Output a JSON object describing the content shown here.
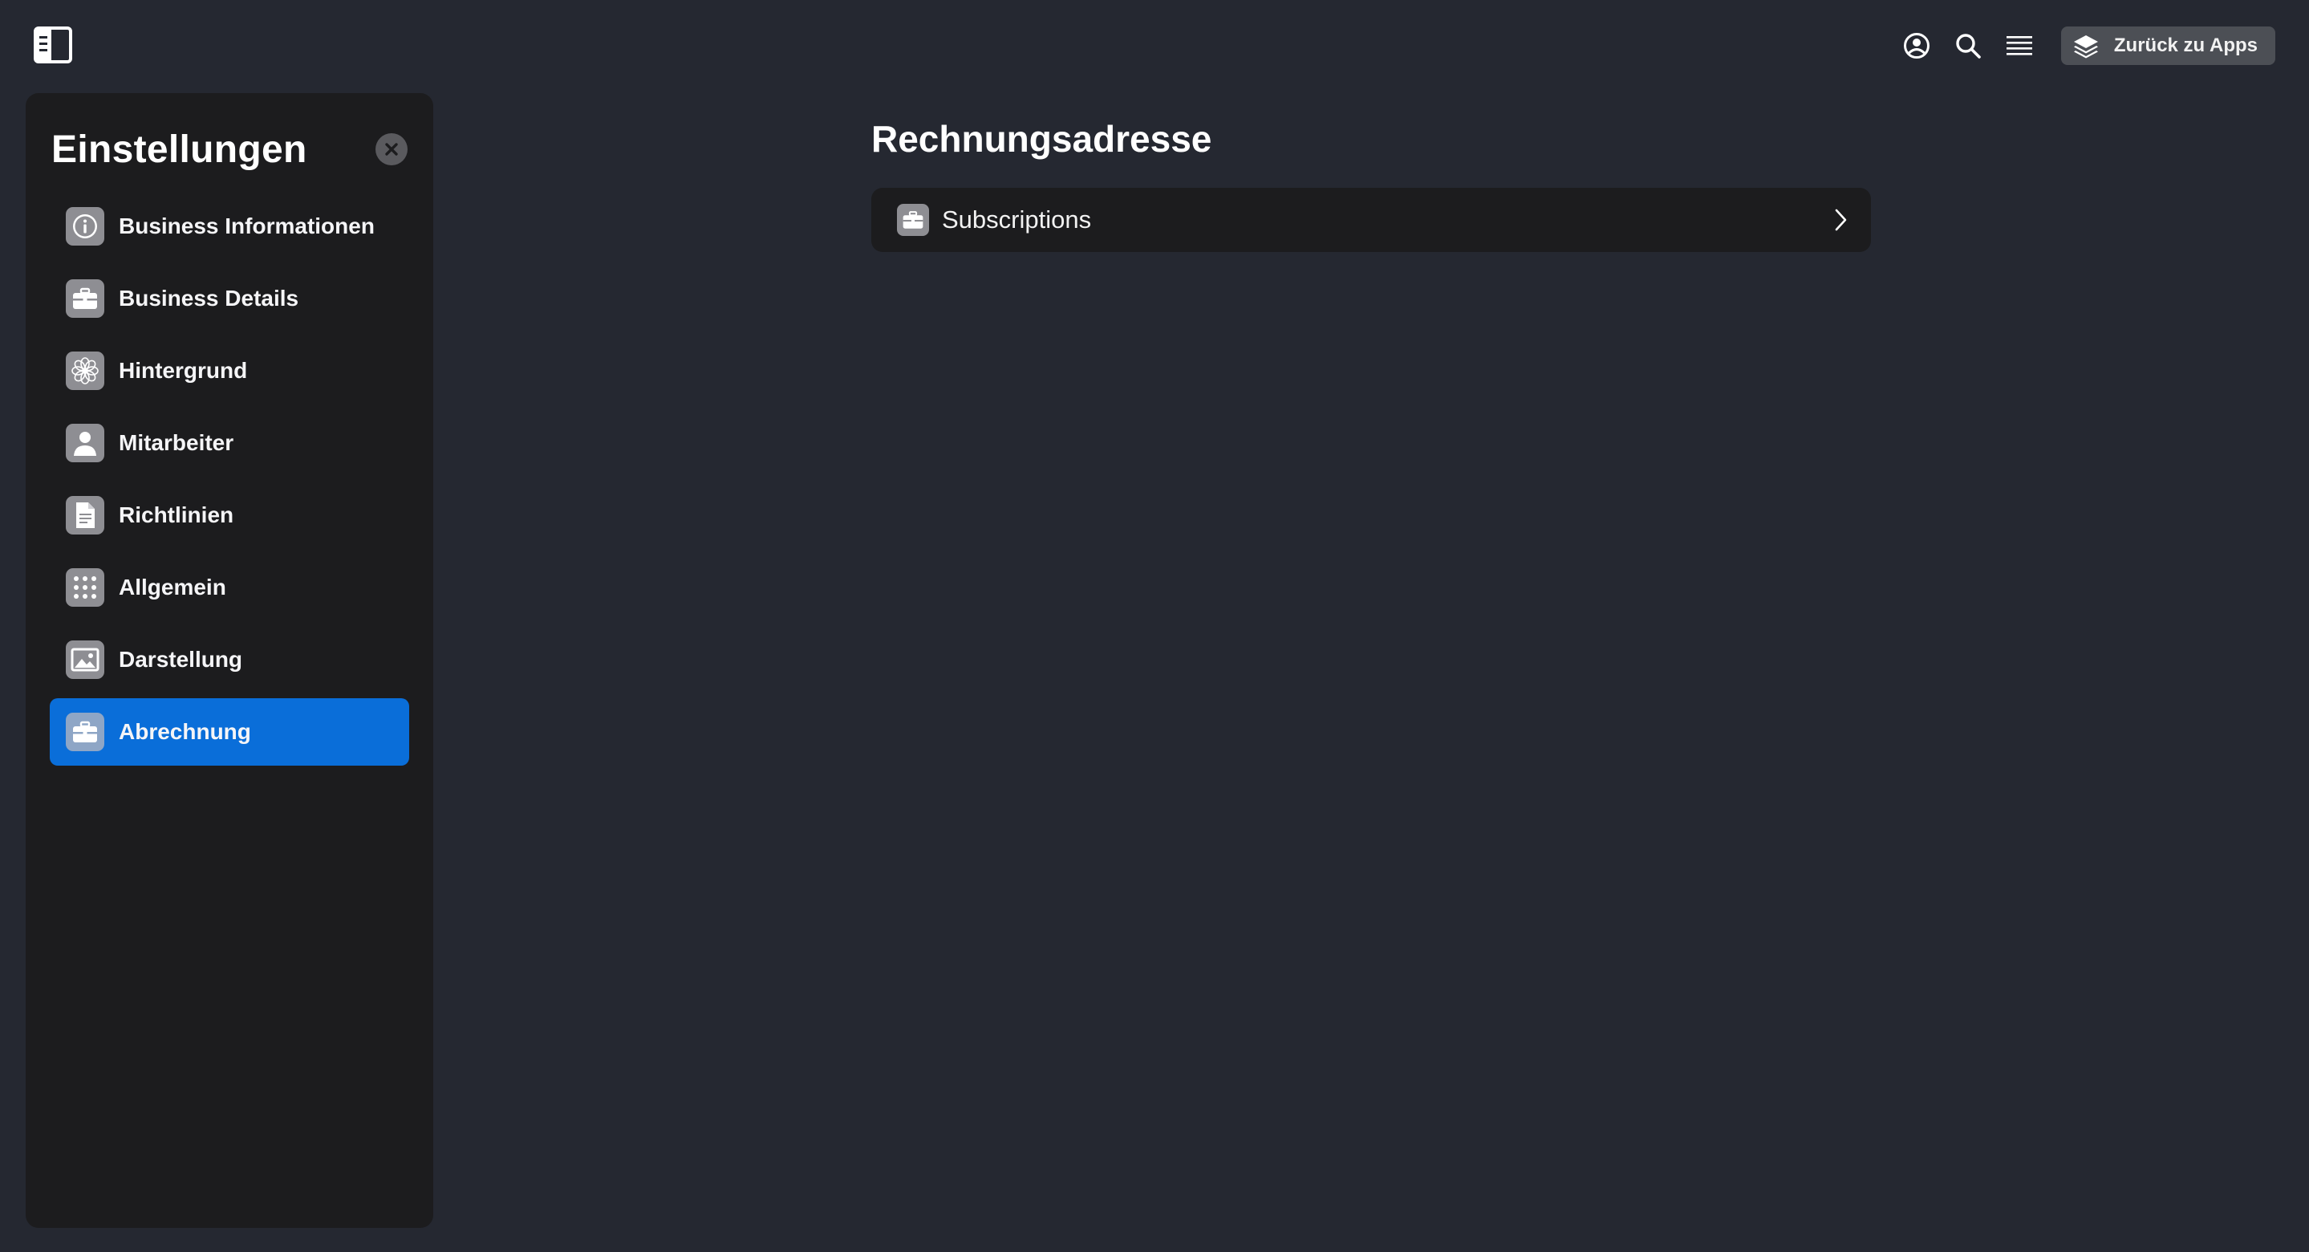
{
  "topbar": {
    "back_label": "Zurück zu Apps",
    "icons": [
      "sidebar-icon",
      "account-icon",
      "search-icon",
      "menu-icon",
      "layers-icon"
    ]
  },
  "sidebar": {
    "title": "Einstellungen",
    "items": [
      {
        "label": "Business Informationen",
        "icon": "info-icon",
        "active": false
      },
      {
        "label": "Business Details",
        "icon": "briefcase-icon",
        "active": false
      },
      {
        "label": "Hintergrund",
        "icon": "flower-icon",
        "active": false
      },
      {
        "label": "Mitarbeiter",
        "icon": "person-icon",
        "active": false
      },
      {
        "label": "Richtlinien",
        "icon": "document-icon",
        "active": false
      },
      {
        "label": "Allgemein",
        "icon": "grid-icon",
        "active": false
      },
      {
        "label": "Darstellung",
        "icon": "image-icon",
        "active": false
      },
      {
        "label": "Abrechnung",
        "icon": "briefcase-icon",
        "active": true
      }
    ]
  },
  "main": {
    "title": "Rechnungsadresse",
    "rows": [
      {
        "label": "Subscriptions",
        "icon": "briefcase-icon"
      }
    ]
  },
  "colors": {
    "background": "#252831",
    "panel": "#1c1c1e",
    "accent": "#0a6ed9",
    "icon_tile": "#8e8e93"
  }
}
